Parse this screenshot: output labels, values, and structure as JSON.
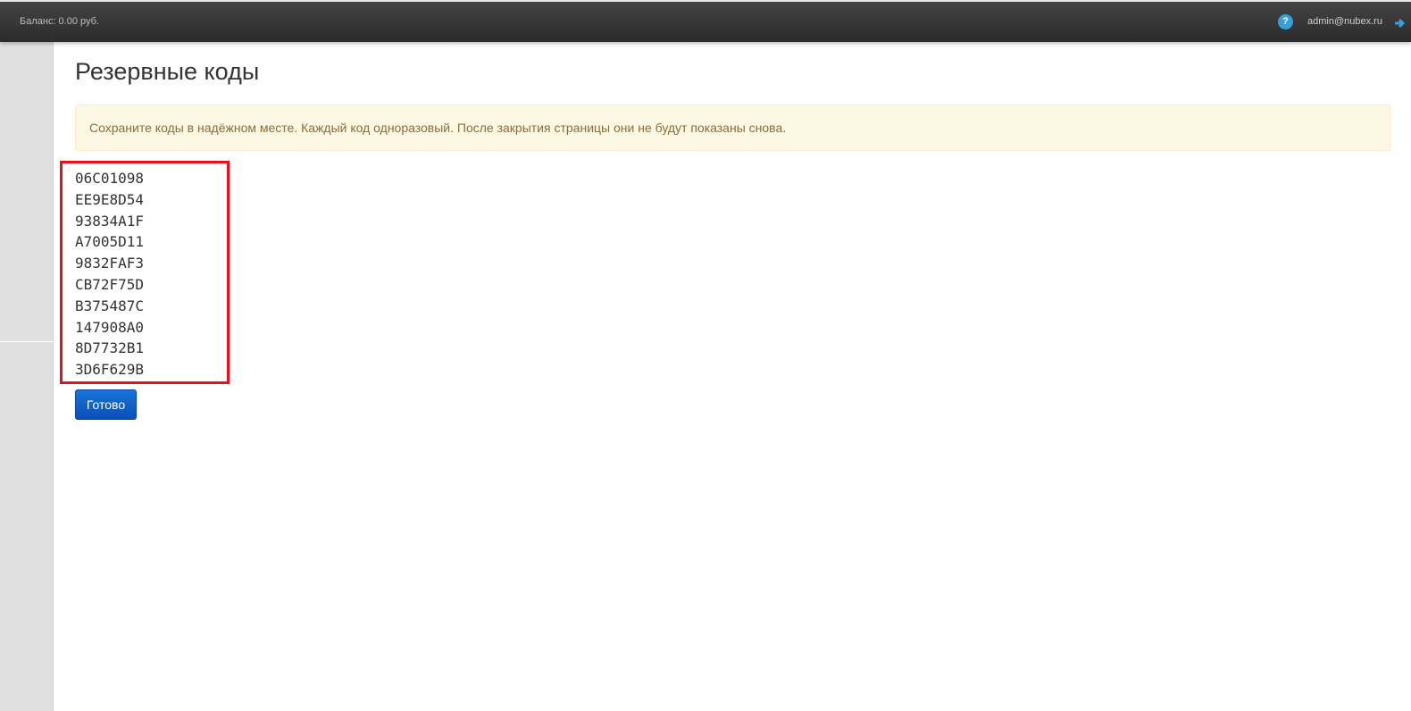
{
  "header": {
    "balance": "Баланс: 0.00 руб.",
    "help_icon": "?",
    "user_email": "admin@nubex.ru"
  },
  "main": {
    "title": "Резервные коды",
    "alert": "Сохраните коды в надёжном месте. Каждый код одноразовый. После закрытия страницы они не будут показаны снова.",
    "codes": [
      "06C01098",
      "EE9E8D54",
      "93834A1F",
      "A7005D11",
      "9832FAF3",
      "CB72F75D",
      "B375487C",
      "147908A0",
      "8D7732B1",
      "3D6F629B"
    ],
    "done_button": "Готово"
  },
  "colors": {
    "topbar": "#333333",
    "alert_background": "#fcf8e3",
    "alert_text": "#8a6d3b",
    "highlight_border": "#e8101a",
    "primary_button": "#0e5fc8",
    "help_icon": "#3a9fd6"
  }
}
